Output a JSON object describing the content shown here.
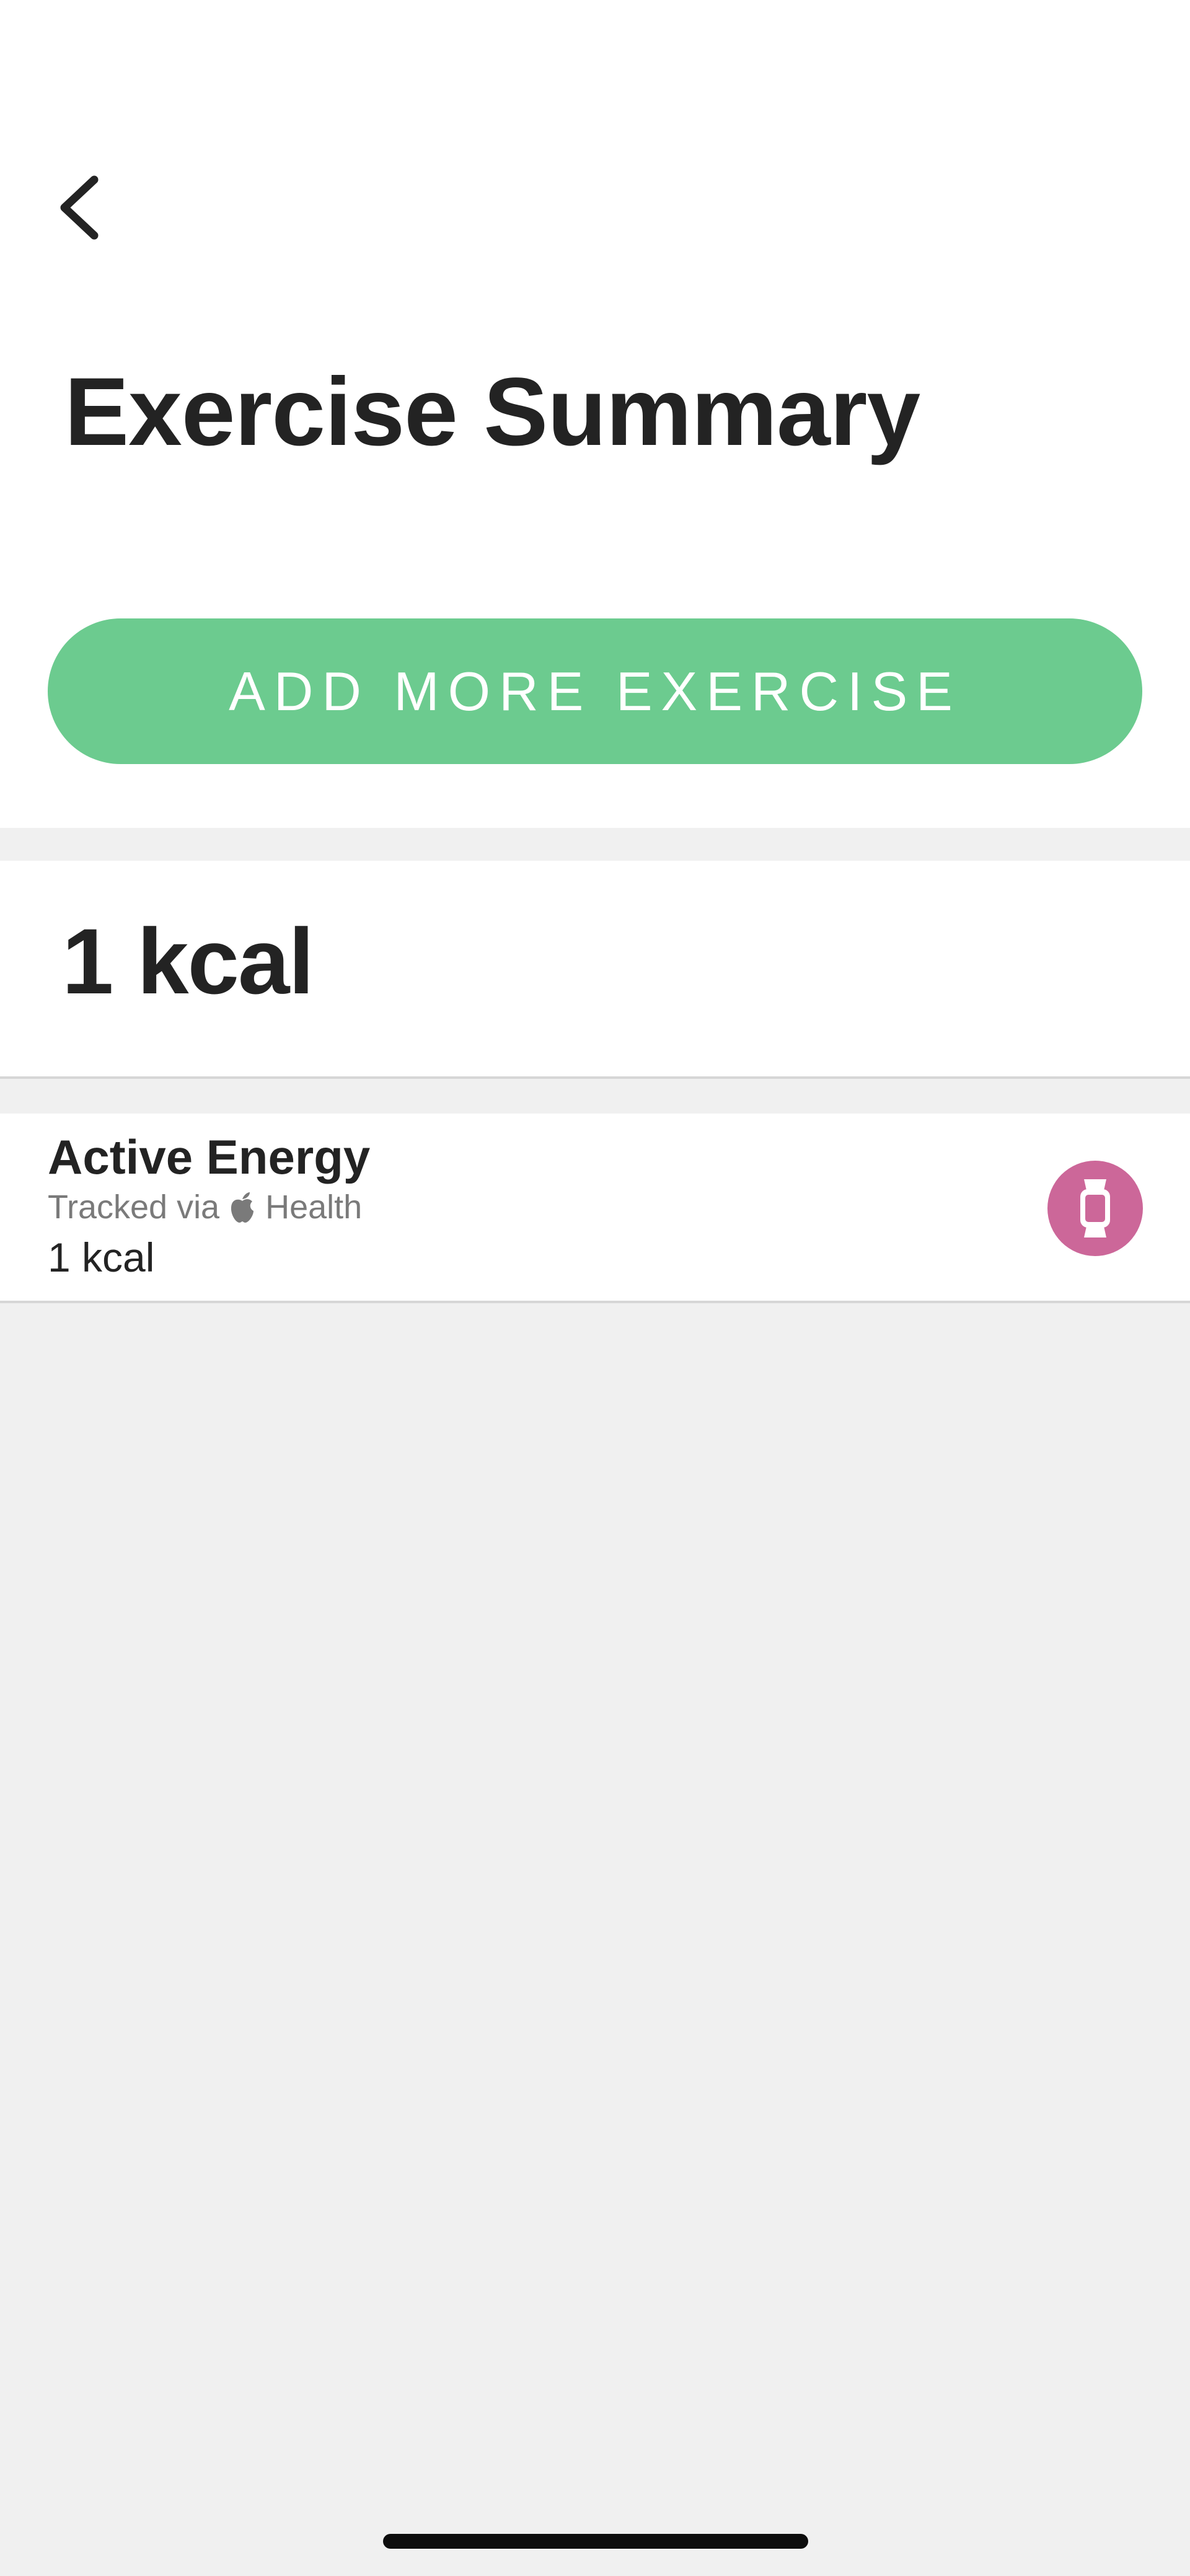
{
  "header": {
    "title": "Exercise Summary",
    "add_button_label": "ADD MORE EXERCISE"
  },
  "summary": {
    "total": "1 kcal"
  },
  "entries": [
    {
      "title": "Active Energy",
      "source_prefix": "Tracked via",
      "source_name": "Health",
      "value": "1 kcal",
      "badge_icon": "watch-icon",
      "badge_color": "#cc6799"
    }
  ],
  "colors": {
    "accent_green": "#6ccb8f",
    "background": "#f0f0f0",
    "text": "#232323"
  }
}
